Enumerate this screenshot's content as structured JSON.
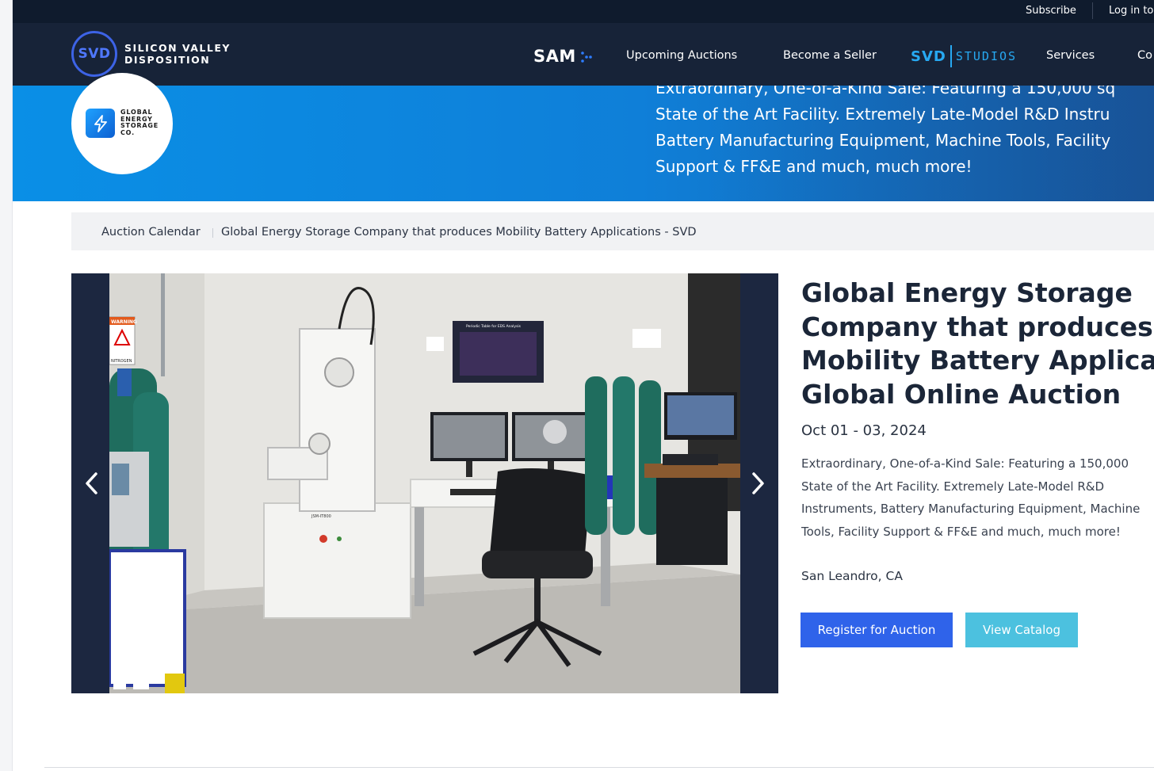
{
  "topbar": {
    "subscribe": "Subscribe",
    "login": "Log in to"
  },
  "nav": {
    "logo_mark": "SVD",
    "logo_line1": "SILICON VALLEY",
    "logo_line2": "DISPOSITION",
    "sam": "SAM",
    "items": [
      {
        "label": "Upcoming Auctions"
      },
      {
        "label": "Become a Seller"
      },
      {
        "label": "Services"
      },
      {
        "label": "Co"
      }
    ],
    "studios_svd": "SVD",
    "studios_label": "STUDIOS"
  },
  "hero": {
    "lines": [
      "Extraordinary, One-of-a-Kind Sale: Featuring a 150,000 sq",
      "State of the Art Facility. Extremely Late-Model R&D Instru",
      "Battery Manufacturing Equipment, Machine Tools, Facility",
      "Support & FF&E and much, much more!"
    ],
    "brand_lines": [
      "GLOBAL",
      "ENERGY",
      "STORAGE",
      "CO."
    ]
  },
  "breadcrumb": {
    "root": "Auction Calendar",
    "current": "Global Energy Storage Company that produces Mobility Battery Applications - SVD"
  },
  "auction": {
    "title_lines": [
      "Global Energy Storage",
      "Company that produces",
      "Mobility Battery Application",
      "Global Online Auction"
    ],
    "date": "Oct 01 - 03, 2024",
    "description_lines": [
      "Extraordinary, One-of-a-Kind Sale: Featuring a 150,000",
      "State of the Art Facility. Extremely Late-Model R&D",
      "Instruments, Battery Manufacturing Equipment, Machine",
      "Tools, Facility Support & FF&E and much, much more!"
    ],
    "location": "San Leandro, CA",
    "register_label": "Register for Auction",
    "catalog_label": "View Catalog"
  },
  "photo": {
    "warning_sign": "WARNING",
    "nitrogen_sign": "NITROGEN",
    "poster_title": "Periodic Table for EDS Analysis",
    "machine_label": "JSM-IT800"
  },
  "colors": {
    "topbar": "#0f1b2d",
    "navbar": "#172338",
    "accent_blue": "#2f63ea",
    "catalog_teal": "#4cc1df",
    "studios_blue": "#27a9f2"
  }
}
